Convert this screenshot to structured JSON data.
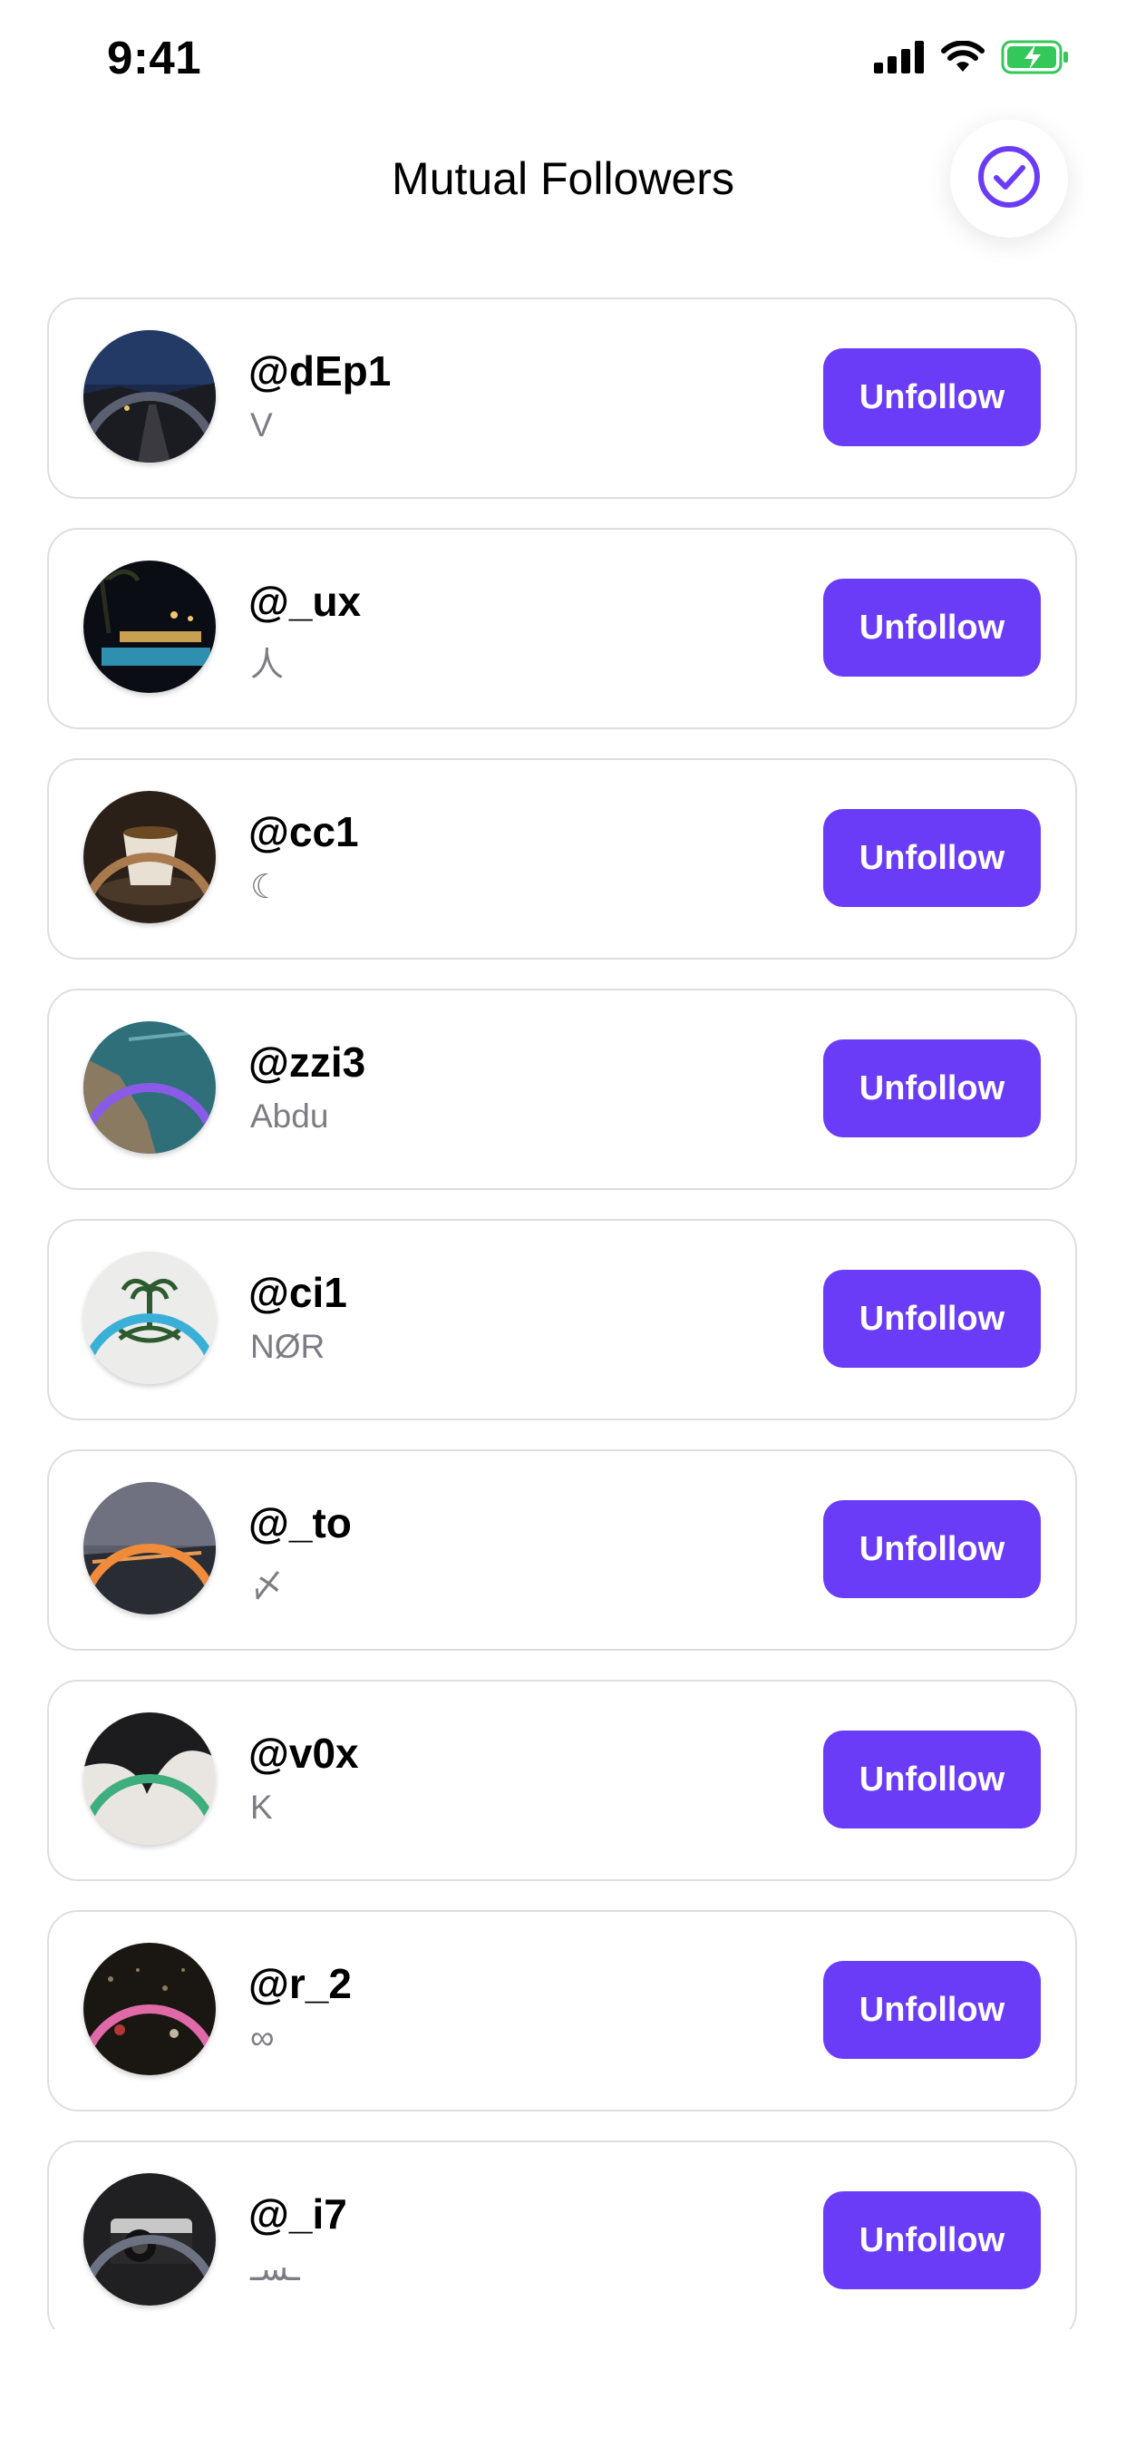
{
  "status_bar": {
    "time": "9:41",
    "icons": [
      "signal-icon",
      "wifi-icon",
      "battery-charging-icon"
    ]
  },
  "header": {
    "title": "Mutual Followers",
    "confirm_icon": "check-circle-icon"
  },
  "colors": {
    "accent": "#6b3cf7",
    "battery": "#34c759",
    "card_border": "#dedede",
    "secondary_text": "#7c7c84"
  },
  "followers": [
    {
      "username": "@dEp1",
      "name": "V",
      "button": "Unfollow",
      "ring": "#5a6070"
    },
    {
      "username": "@_ux",
      "name": "人",
      "button": "Unfollow",
      "ring": "#4f7fe0"
    },
    {
      "username": "@cc1",
      "name": "☾",
      "button": "Unfollow",
      "ring": "#a87a4e"
    },
    {
      "username": "@zzi3",
      "name": "Abdu",
      "button": "Unfollow",
      "ring": "#8a5be6"
    },
    {
      "username": "@ci1",
      "name": "NØR",
      "button": "Unfollow",
      "ring": "#3ab0d8"
    },
    {
      "username": "@_to",
      "name": "〆",
      "button": "Unfollow",
      "ring": "#ef8b3a"
    },
    {
      "username": "@v0x",
      "name": "K",
      "button": "Unfollow",
      "ring": "#3fae7e"
    },
    {
      "username": "@r_2",
      "name": "∞",
      "button": "Unfollow",
      "ring": "#e06aa8"
    },
    {
      "username": "@_i7",
      "name": "ـسـ",
      "button": "Unfollow",
      "ring": "#6c7282"
    }
  ]
}
